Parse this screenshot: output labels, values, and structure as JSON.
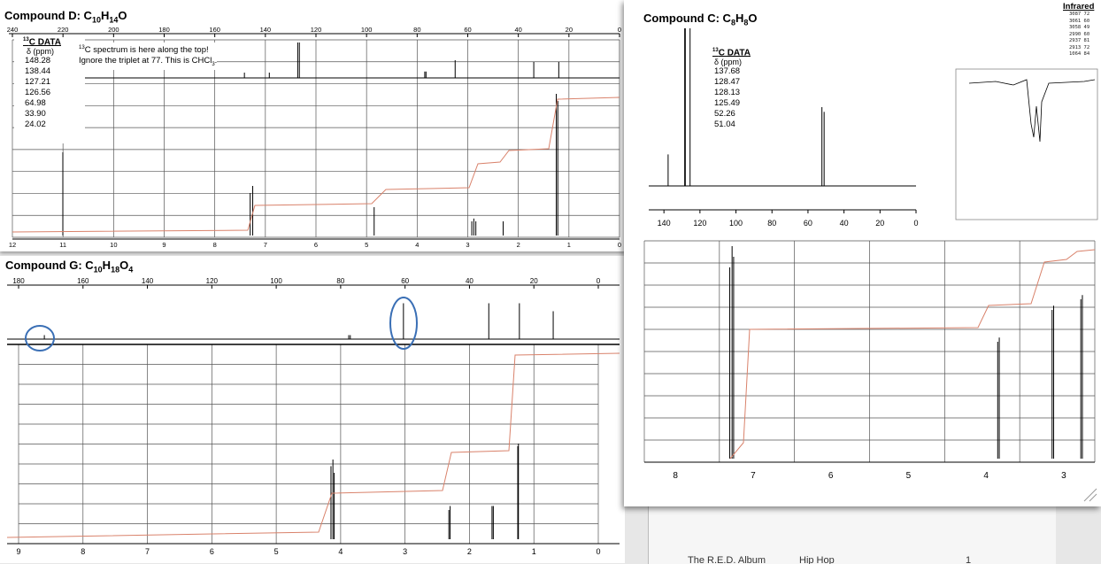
{
  "compound_d": {
    "name": "Compound D: ",
    "formula": [
      "C",
      "10",
      "H",
      "14",
      "O"
    ],
    "c13_header": "13C DATA",
    "c13_sup": "13",
    "c13_word": "C DATA",
    "c13_unit": "δ (ppm)",
    "c13_values": [
      "148.28",
      "138.44",
      "127.21",
      "126.56",
      "64.98",
      "33.90",
      "24.02"
    ],
    "note_line1_sup": "13",
    "note_line1": "C spectrum is here along the top!",
    "note_line2": "Ignore the triplet at 77. This is CHCl",
    "note_line2_sub": "3",
    "note_line2_end": "."
  },
  "compound_g": {
    "name": "Compound G: ",
    "formula": [
      "C",
      "10",
      "H",
      "18",
      "O",
      "4"
    ]
  },
  "compound_c": {
    "name": "Compound C: ",
    "formula": [
      "C",
      "8",
      "H",
      "8",
      "O"
    ],
    "c13_sup": "13",
    "c13_word": "C DATA",
    "c13_unit": "δ (ppm)",
    "c13_values": [
      "137.68",
      "128.47",
      "128.13",
      "125.49",
      "52.26",
      "51.04"
    ],
    "ir_title": "Infrared",
    "ir_table": [
      [
        "3087",
        "72"
      ],
      [
        "3061",
        "60"
      ],
      [
        "3058",
        "49"
      ],
      [
        "2990",
        "60"
      ],
      [
        "2937",
        "81"
      ],
      [
        "2913",
        "72"
      ],
      [
        "1064",
        "84"
      ]
    ]
  },
  "background_window": {
    "col1": "The R.E.D. Album",
    "col2": "Hip Hop",
    "col3": "1"
  },
  "colors": {
    "spectrum": "#000000",
    "integral": "#d9826b",
    "grid": "#555555",
    "circle": "#3a6fb5"
  },
  "chart_data": [
    {
      "type": "line",
      "id": "D-13C",
      "xlabel": "",
      "ylabel": "",
      "x_ticks": [
        240,
        220,
        200,
        180,
        160,
        140,
        120,
        100,
        80,
        60,
        40,
        20,
        0
      ],
      "xlim": [
        240,
        0
      ],
      "peaks_ppm": [
        148.28,
        138.44,
        127.21,
        126.56,
        64.98,
        33.9,
        24.02
      ],
      "series": [
        {
          "values": [
            [
              148.28,
              0.15
            ],
            [
              138.44,
              0.15
            ],
            [
              127.21,
              1.0
            ],
            [
              126.56,
              1.0
            ],
            [
              77,
              0.18
            ],
            [
              76.5,
              0.18
            ],
            [
              64.98,
              0.5
            ],
            [
              33.9,
              0.45
            ],
            [
              24.02,
              0.45
            ]
          ]
        }
      ]
    },
    {
      "type": "line",
      "id": "D-1H",
      "x_ticks": [
        12,
        11,
        10,
        9,
        8,
        7,
        6,
        5,
        4,
        3,
        2,
        1,
        0
      ],
      "xlim": [
        12,
        0
      ],
      "series": [
        {
          "values": [
            [
              7.3,
              0.3
            ],
            [
              7.25,
              0.35
            ],
            [
              4.85,
              0.2
            ],
            [
              2.92,
              0.1
            ],
            [
              2.88,
              0.12
            ],
            [
              2.84,
              0.1
            ],
            [
              2.3,
              0.1
            ],
            [
              1.25,
              1.0
            ],
            [
              1.22,
              0.95
            ]
          ]
        }
      ]
    },
    {
      "type": "line",
      "id": "G-13C",
      "x_ticks": [
        180,
        160,
        140,
        120,
        100,
        80,
        60,
        40,
        20,
        0
      ],
      "xlim": [
        180,
        0
      ],
      "series": [
        {
          "values": [
            [
              172,
              0.1
            ],
            [
              60.5,
              0.9
            ],
            [
              34,
              0.9
            ],
            [
              24.5,
              0.9
            ],
            [
              14,
              0.7
            ],
            [
              77.5,
              0.1
            ],
            [
              77,
              0.1
            ]
          ]
        }
      ]
    },
    {
      "type": "line",
      "id": "G-1H",
      "x_ticks": [
        9,
        8,
        7,
        6,
        5,
        4,
        3,
        2,
        1,
        0
      ],
      "xlim": [
        9,
        0
      ],
      "series": [
        {
          "values": [
            [
              4.15,
              0.55
            ],
            [
              4.12,
              0.6
            ],
            [
              4.1,
              0.5
            ],
            [
              2.32,
              0.22
            ],
            [
              2.3,
              0.25
            ],
            [
              1.65,
              0.25
            ],
            [
              1.63,
              0.25
            ],
            [
              1.25,
              0.7
            ],
            [
              1.24,
              0.72
            ]
          ]
        }
      ]
    },
    {
      "type": "line",
      "id": "C-13C",
      "x_ticks": [
        140,
        120,
        100,
        80,
        60,
        40,
        20,
        0
      ],
      "xlim": [
        145,
        0
      ],
      "peaks_ppm": [
        137.68,
        128.47,
        128.13,
        125.49,
        52.26,
        51.04
      ],
      "series": [
        {
          "values": [
            [
              137.68,
              0.2
            ],
            [
              128.47,
              1.0
            ],
            [
              128.13,
              1.0
            ],
            [
              125.49,
              1.0
            ],
            [
              52.26,
              0.5
            ],
            [
              51.04,
              0.47
            ]
          ]
        }
      ]
    },
    {
      "type": "line",
      "id": "C-1H",
      "x_ticks": [
        8,
        7,
        6,
        5,
        4,
        3
      ],
      "xlim": [
        8.4,
        2.6
      ],
      "series": [
        {
          "values": [
            [
              7.3,
              0.9
            ],
            [
              7.27,
              1.0
            ],
            [
              7.25,
              0.95
            ],
            [
              3.85,
              0.55
            ],
            [
              3.83,
              0.57
            ],
            [
              3.15,
              0.7
            ],
            [
              3.13,
              0.72
            ],
            [
              2.78,
              0.75
            ],
            [
              2.76,
              0.77
            ]
          ]
        }
      ]
    },
    {
      "type": "line",
      "id": "C-IR",
      "title": "Infrared"
    }
  ]
}
